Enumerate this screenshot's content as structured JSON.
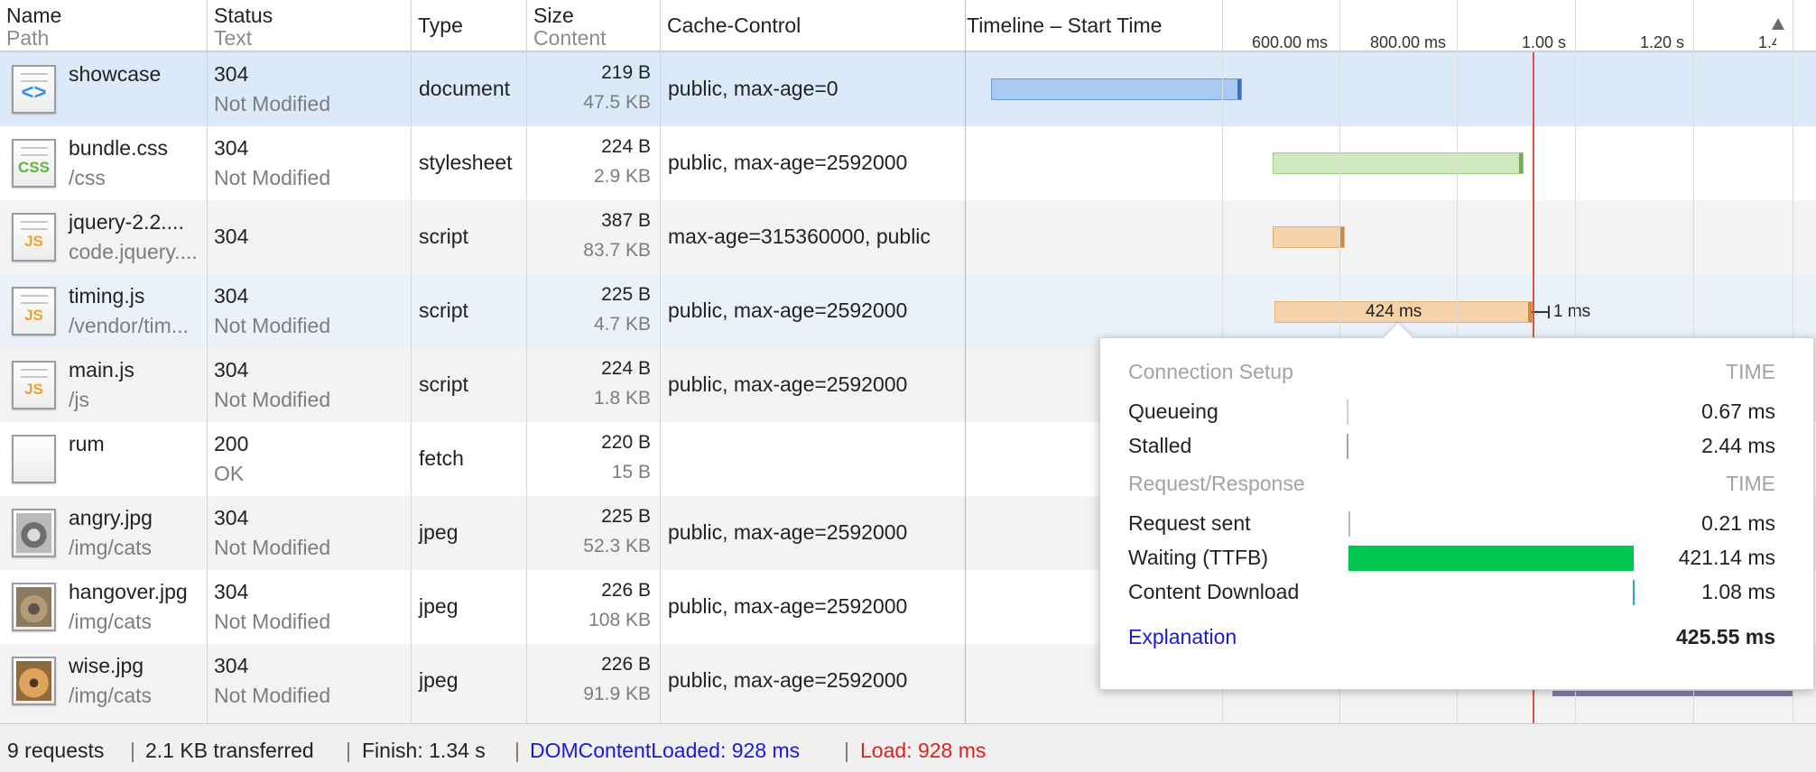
{
  "columns": {
    "name": {
      "line1": "Name",
      "line2": "Path"
    },
    "status": {
      "line1": "Status",
      "line2": "Text"
    },
    "type": {
      "label": "Type"
    },
    "size": {
      "line1": "Size",
      "line2": "Content"
    },
    "cache": {
      "label": "Cache-Control"
    },
    "timeline": {
      "label": "Timeline – Start Time"
    }
  },
  "timeline_ticks": [
    "600.00 ms",
    "800.00 ms",
    "1.00 s",
    "1.20 s",
    "1.4"
  ],
  "rows": [
    {
      "name": "showcase",
      "path": "",
      "status": "304",
      "status_text": "Not Modified",
      "type": "document",
      "size": "219 B",
      "content": "47.5 KB",
      "cache": "public, max-age=0",
      "icon": "document-icon"
    },
    {
      "name": "bundle.css",
      "path": "/css",
      "status": "304",
      "status_text": "Not Modified",
      "type": "stylesheet",
      "size": "224 B",
      "content": "2.9 KB",
      "cache": "public, max-age=2592000",
      "icon": "css-file-icon"
    },
    {
      "name": "jquery-2.2....",
      "path": "code.jquery....",
      "status": "304",
      "status_text": "",
      "type": "script",
      "size": "387 B",
      "content": "83.7 KB",
      "cache": "max-age=315360000, public",
      "icon": "js-file-icon"
    },
    {
      "name": "timing.js",
      "path": "/vendor/tim...",
      "status": "304",
      "status_text": "Not Modified",
      "type": "script",
      "size": "225 B",
      "content": "4.7 KB",
      "cache": "public, max-age=2592000",
      "icon": "js-file-icon"
    },
    {
      "name": "main.js",
      "path": "/js",
      "status": "304",
      "status_text": "Not Modified",
      "type": "script",
      "size": "224 B",
      "content": "1.8 KB",
      "cache": "public, max-age=2592000",
      "icon": "js-file-icon"
    },
    {
      "name": "rum",
      "path": "",
      "status": "200",
      "status_text": "OK",
      "type": "fetch",
      "size": "220 B",
      "content": "15 B",
      "cache": "",
      "icon": "blank-file-icon"
    },
    {
      "name": "angry.jpg",
      "path": "/img/cats",
      "status": "304",
      "status_text": "Not Modified",
      "type": "jpeg",
      "size": "225 B",
      "content": "52.3 KB",
      "cache": "public, max-age=2592000",
      "icon": "image-thumbnail-icon"
    },
    {
      "name": "hangover.jpg",
      "path": "/img/cats",
      "status": "304",
      "status_text": "Not Modified",
      "type": "jpeg",
      "size": "226 B",
      "content": "108 KB",
      "cache": "public, max-age=2592000",
      "icon": "image-thumbnail-icon"
    },
    {
      "name": "wise.jpg",
      "path": "/img/cats",
      "status": "304",
      "status_text": "Not Modified",
      "type": "jpeg",
      "size": "226 B",
      "content": "91.9 KB",
      "cache": "public, max-age=2592000",
      "icon": "image-thumbnail-icon"
    }
  ],
  "timeline_labels": {
    "timing_duration": "424 ms",
    "timing_after": "1 ms"
  },
  "colors": {
    "document_bar": "#a9c8f2",
    "stylesheet_bar": "#cfe9bf",
    "script_bar": "#f5d2aa",
    "ttfb_bar": "#00c54f",
    "load_line": "#e0523f",
    "domcontentloaded_text": "#1a1ad6",
    "load_text": "#e0201b",
    "selected_row": "#dce9f8"
  },
  "timing_popover": {
    "connection_header": "Connection Setup",
    "time_label": "TIME",
    "queueing_label": "Queueing",
    "queueing_value": "0.67 ms",
    "stalled_label": "Stalled",
    "stalled_value": "2.44 ms",
    "reqres_header": "Request/Response",
    "request_sent_label": "Request sent",
    "request_sent_value": "0.21 ms",
    "waiting_label": "Waiting (TTFB)",
    "waiting_value": "421.14 ms",
    "download_label": "Content Download",
    "download_value": "1.08 ms",
    "explanation_link": "Explanation",
    "total_value": "425.55 ms"
  },
  "status_bar": {
    "requests": "9 requests",
    "transferred": "2.1 KB transferred",
    "finish": "Finish: 1.34 s",
    "domcontentloaded": "DOMContentLoaded: 928 ms",
    "load": "Load: 928 ms",
    "separator": "|"
  }
}
